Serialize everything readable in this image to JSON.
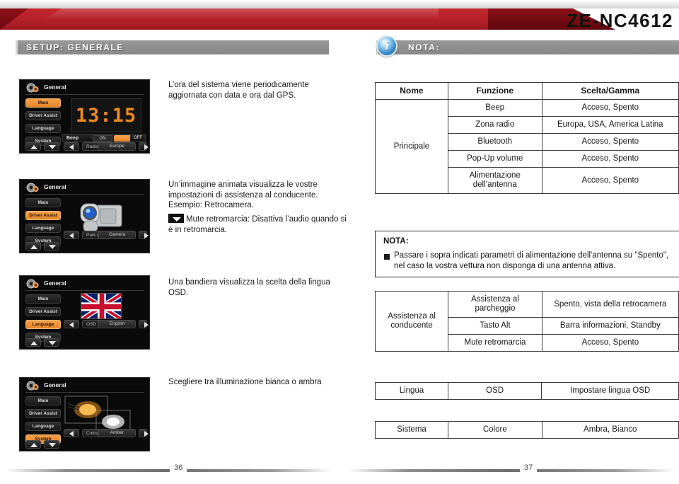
{
  "header": {
    "model": "ZE-NC4612",
    "setup_bar_label": "SETUP: GENERALE",
    "note_bar_label": "NOTA:",
    "info_glyph": "i"
  },
  "devices": [
    {
      "title": "General",
      "menu": [
        "Main",
        "Driver Assist",
        "Language",
        "System"
      ],
      "selected": "Main",
      "clock": "13:15",
      "beep_label": "Beep",
      "beep_on": "ON",
      "beep_off": "OFF",
      "field_key": "Radio Area",
      "field_value": "Europe"
    },
    {
      "title": "General",
      "menu": [
        "Main",
        "Driver Assist",
        "Language",
        "System"
      ],
      "selected": "Driver Assist",
      "field_key": "Park Assist",
      "field_value": "Camera"
    },
    {
      "title": "General",
      "menu": [
        "Main",
        "Driver Assist",
        "Language",
        "System"
      ],
      "selected": "Language",
      "field_key": "OSD",
      "field_value": "English"
    },
    {
      "title": "General",
      "menu": [
        "Main",
        "Driver Assist",
        "Language",
        "System"
      ],
      "selected": "System",
      "field_key": "Colour",
      "field_value": "Amber"
    }
  ],
  "paragraphs": {
    "p1": "L’ora del sistema viene periodicamente aggiornata con data e ora dal GPS.",
    "p2": "Un’immagine animata visualizza le vostre impostazioni di assistenza al conducente. Esempio: Retrocamera.",
    "p2b": "Mute retromarcia: Disattiva l’audio quando si è in retromarcia.",
    "p3": "Una bandiera visualizza la scelta della lingua OSD.",
    "p4": "Scegliere tra illuminazione bianca o ambra"
  },
  "table_main": {
    "headers": [
      "Nome",
      "Funzione",
      "Scelta/Gamma"
    ],
    "group": "Principale",
    "rows": [
      {
        "funzione": "Beep",
        "scelta": "Acceso, Spento"
      },
      {
        "funzione": "Zona radio",
        "scelta": "Europa, USA, America Latina"
      },
      {
        "funzione": "Bluetooth",
        "scelta": "Acceso, Spento"
      },
      {
        "funzione": "Pop-Up volume",
        "scelta": "Acceso, Spento"
      },
      {
        "funzione": "Alimentazione dell’antenna",
        "scelta": "Acceso, Spento"
      }
    ]
  },
  "note_box": {
    "title": "NOTA:",
    "text": "Passare i sopra indicati parametri di alimentazione dell'antenna su \"Spento\", nel caso la vostra vettura non disponga di una antenna attiva."
  },
  "table_assist": {
    "group": "Assistenza al conducente",
    "rows": [
      {
        "funzione": "Assistenza al parcheggio",
        "scelta": "Spento, vista della retrocamera"
      },
      {
        "funzione": "Tasto Alt",
        "scelta": "Barra informazioni, Standby"
      },
      {
        "funzione": "Mute retromarcia",
        "scelta": "Acceso, Spento"
      }
    ]
  },
  "table_lingua": {
    "nome": "Lingua",
    "funzione": "OSD",
    "scelta": "Impostare lingua OSD"
  },
  "table_sistema": {
    "nome": "Sistema",
    "funzione": "Colore",
    "scelta": "Ambra, Bianco"
  },
  "footer": {
    "page_left": "36",
    "page_right": "37"
  },
  "colors": {
    "brand_red": "#b5202a",
    "brand_red_dark": "#6d0b10",
    "bar_grey": "#8e8e8e",
    "device_black": "#0a0a0a",
    "accent_orange": "#e4862a",
    "clock_orange": "#ef8b22"
  }
}
